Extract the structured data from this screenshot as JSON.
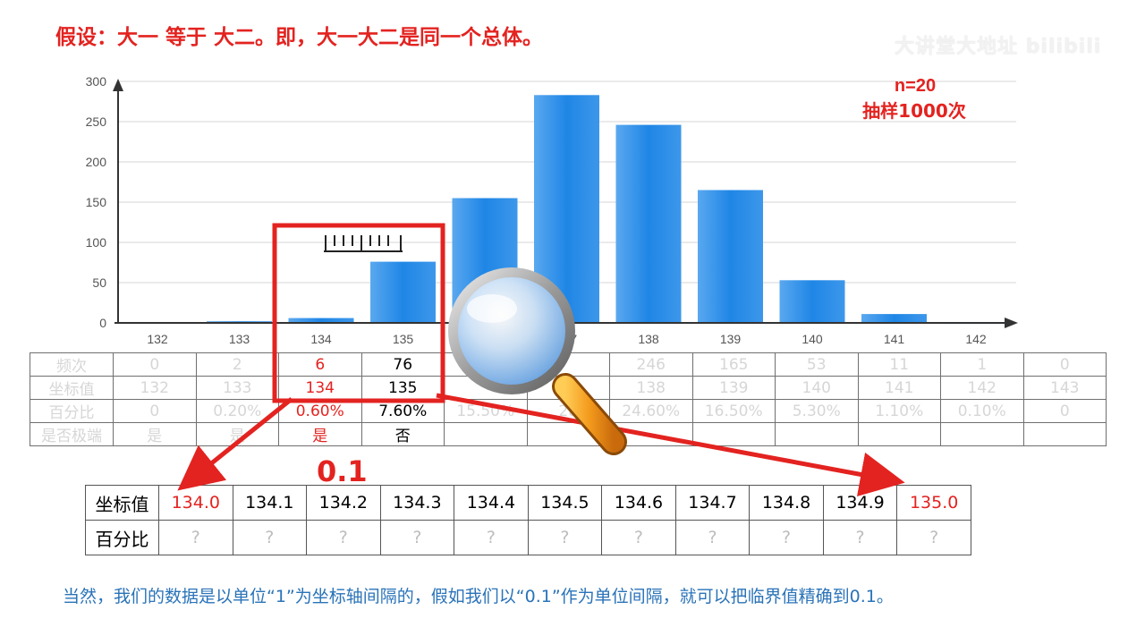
{
  "title": "假设：大一 等于 大二。即，大一大二是同一个总体。",
  "watermark": "大讲堂大地址 bilibili",
  "annotation": {
    "line1": "n=20",
    "line2": "抽样1000次"
  },
  "colors": {
    "accent": "#e32320",
    "bar": "#2b8be6",
    "note": "#2a73b8"
  },
  "chart_data": {
    "type": "bar",
    "categories": [
      "132",
      "133",
      "134",
      "135",
      "136",
      "137",
      "138",
      "139",
      "140",
      "141",
      "142"
    ],
    "values": [
      0,
      2,
      6,
      76,
      155,
      283,
      246,
      165,
      53,
      11,
      1
    ],
    "ylim": [
      0,
      300
    ],
    "yticks": [
      0,
      50,
      100,
      150,
      200,
      250,
      300
    ],
    "grid": true
  },
  "freq_table": {
    "labels": [
      "频次",
      "坐标值",
      "百分比",
      "是否极端"
    ],
    "freq": [
      "0",
      "2",
      "6",
      "76",
      "155",
      "",
      "246",
      "165",
      "53",
      "11",
      "1",
      "0"
    ],
    "coord": [
      "132",
      "133",
      "134",
      "135",
      "",
      "",
      "138",
      "139",
      "140",
      "141",
      "142",
      "143"
    ],
    "pct": [
      "0",
      "0.20%",
      "0.60%",
      "7.60%",
      "15.50%",
      "28",
      "24.60%",
      "16.50%",
      "5.30%",
      "1.10%",
      "0.10%",
      "0"
    ],
    "extreme": [
      "是",
      "是",
      "是",
      "否",
      "",
      "",
      "",
      "",
      "",
      "",
      "",
      ""
    ]
  },
  "step_label": "0.1",
  "fine_table": {
    "coord_label": "坐标值",
    "pct_label": "百分比",
    "coords": [
      "134.0",
      "134.1",
      "134.2",
      "134.3",
      "134.4",
      "134.5",
      "134.6",
      "134.7",
      "134.8",
      "134.9",
      "135.0"
    ],
    "pcts": [
      "?",
      "?",
      "?",
      "?",
      "?",
      "?",
      "?",
      "?",
      "?",
      "?",
      "?"
    ]
  },
  "note": "当然，我们的数据是以单位“1”为坐标轴间隔的，假如我们以“0.1”作为单位间隔，就可以把临界值精确到0.1。"
}
